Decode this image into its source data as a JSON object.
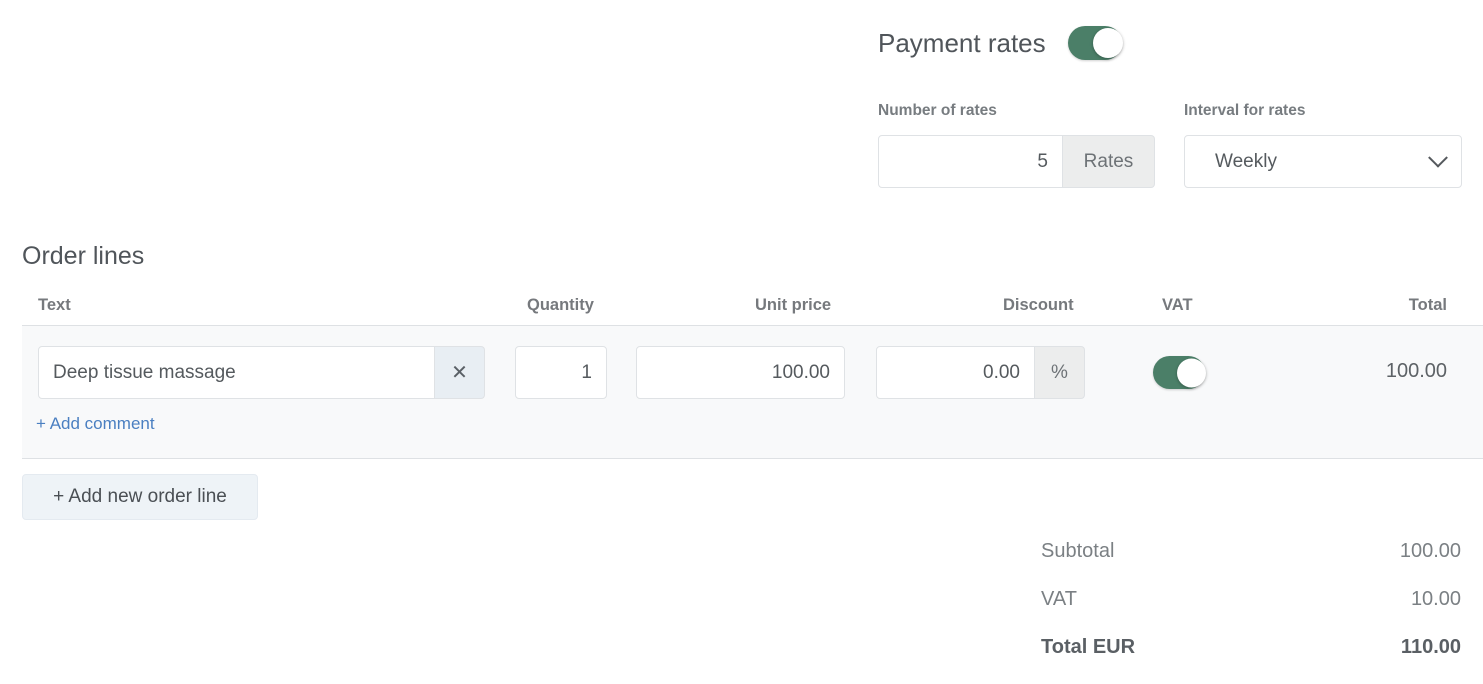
{
  "payment_rates": {
    "title": "Payment rates",
    "toggle_on": true,
    "number_of_rates": {
      "label": "Number of rates",
      "value": "5",
      "addon": "Rates"
    },
    "interval_for_rates": {
      "label": "Interval for rates",
      "value": "Weekly"
    }
  },
  "order_lines": {
    "title": "Order lines",
    "columns": {
      "text": "Text",
      "quantity": "Quantity",
      "unit_price": "Unit price",
      "discount": "Discount",
      "vat": "VAT",
      "total": "Total"
    },
    "rows": [
      {
        "text": "Deep tissue massage",
        "remove_icon": "close-icon",
        "quantity": "1",
        "unit_price": "100.00",
        "discount": "0.00",
        "discount_addon": "%",
        "vat_on": true,
        "total": "100.00",
        "add_comment": "+ Add comment"
      }
    ],
    "add_new_line": "+ Add new order line"
  },
  "totals": [
    {
      "label": "Subtotal",
      "value": "100.00",
      "emphasis": false
    },
    {
      "label": "VAT",
      "value": "10.00",
      "emphasis": false
    },
    {
      "label": "Total EUR",
      "value": "110.00",
      "emphasis": true
    }
  ],
  "colors": {
    "toggle_on": "#4b7f68",
    "link": "#4a7fc1",
    "row_background": "#f8f9fa",
    "addon_background": "#eceded",
    "button_background": "#eef3f7"
  }
}
